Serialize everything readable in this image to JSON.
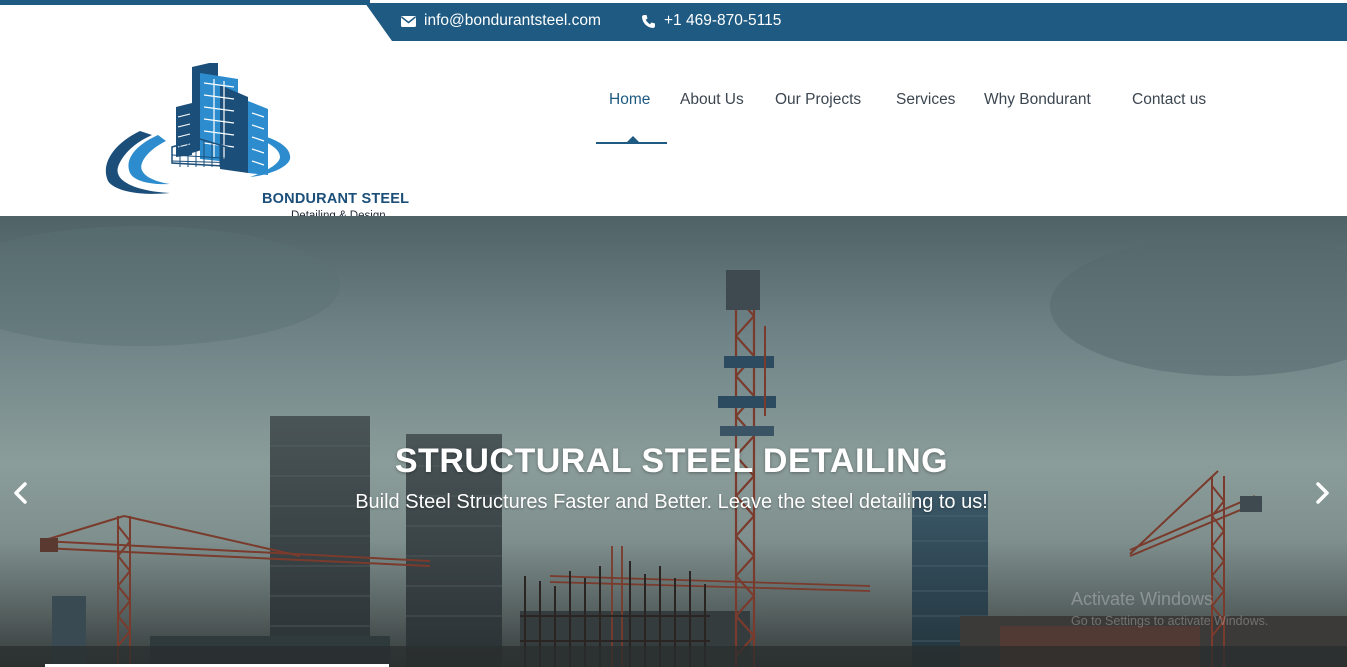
{
  "topbar": {
    "email": "info@bondurantsteel.com",
    "phone": "+1 469-870-5115",
    "email_icon": "envelope-icon",
    "phone_icon": "phone-icon"
  },
  "logo": {
    "title": "BONDURANT STEEL",
    "subtitle": "Detailing & Design"
  },
  "nav": {
    "items": [
      {
        "label": "Home",
        "active": true
      },
      {
        "label": "About Us"
      },
      {
        "label": "Our Projects"
      },
      {
        "label": "Services"
      },
      {
        "label": "Why Bondurant"
      },
      {
        "label": "Contact us"
      }
    ]
  },
  "hero": {
    "title": "STRUCTURAL STEEL DETAILING",
    "subtitle": "Build Steel Structures Faster and Better. Leave the steel detailing to us!",
    "prev_icon": "chevron-left-icon",
    "next_icon": "chevron-right-icon"
  },
  "watermark": {
    "line1": "Activate Windows",
    "line2": "Go to Settings to activate Windows."
  },
  "colors": {
    "brand": "#1e5a82",
    "nav_text": "#3c4650"
  }
}
